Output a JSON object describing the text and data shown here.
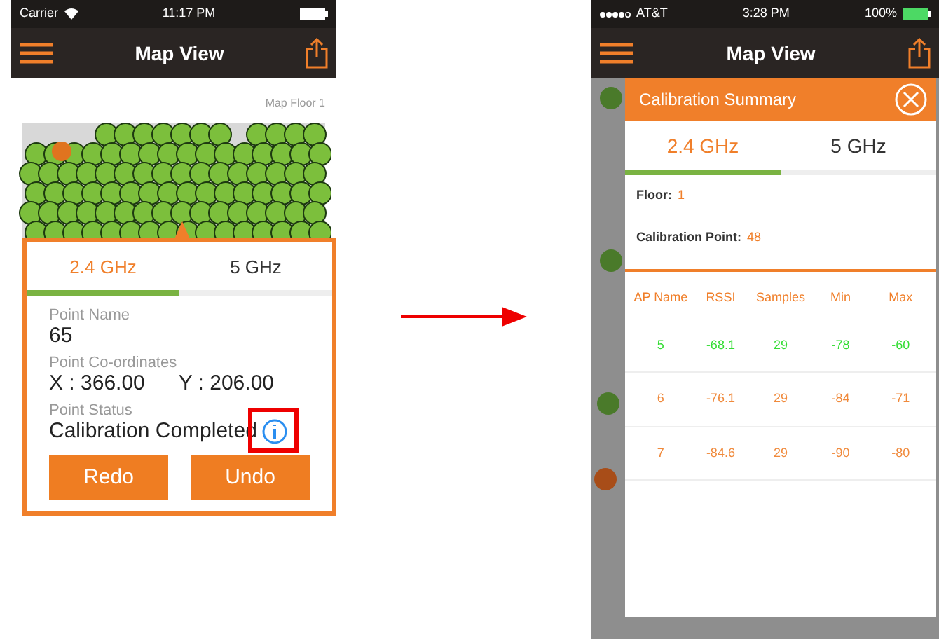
{
  "left_phone": {
    "status_bar": {
      "carrier": "Carrier",
      "time": "11:17 PM"
    },
    "nav_bar": {
      "title": "Map View"
    },
    "map": {
      "floor_label": "Map Floor 1"
    },
    "point_popup": {
      "tabs": [
        {
          "label": "2.4 GHz",
          "selected": true
        },
        {
          "label": "5 GHz",
          "selected": false
        }
      ],
      "name_label": "Point Name",
      "name_value": "65",
      "coords_label": "Point Co-ordinates",
      "x_value": "X : 366.00",
      "y_value": "Y : 206.00",
      "status_label": "Point Status",
      "status_value": "Calibration Completed",
      "buttons": [
        "Redo",
        "Undo"
      ]
    }
  },
  "right_phone": {
    "status_bar": {
      "carrier": "AT&T",
      "time": "3:28 PM",
      "battery": "100%"
    },
    "nav_bar": {
      "title": "Map View"
    },
    "summary": {
      "title": "Calibration Summary",
      "tabs": [
        {
          "label": "2.4 GHz",
          "selected": true
        },
        {
          "label": "5 GHz",
          "selected": false
        }
      ],
      "floor_label": "Floor:",
      "floor_value": "1",
      "point_label": "Calibration Point:",
      "point_value": "48",
      "table": {
        "columns": [
          "AP Name",
          "RSSI",
          "Samples",
          "Min",
          "Max"
        ],
        "rows": [
          {
            "cells": [
              "5",
              "-68.1",
              "29",
              "-78",
              "-60"
            ],
            "color": "#33dd33"
          },
          {
            "cells": [
              "6",
              "-76.1",
              "29",
              "-84",
              "-71"
            ],
            "color": "#f08a3c"
          },
          {
            "cells": [
              "7",
              "-84.6",
              "29",
              "-90",
              "-80"
            ],
            "color": "#f08a3c"
          }
        ]
      }
    }
  }
}
